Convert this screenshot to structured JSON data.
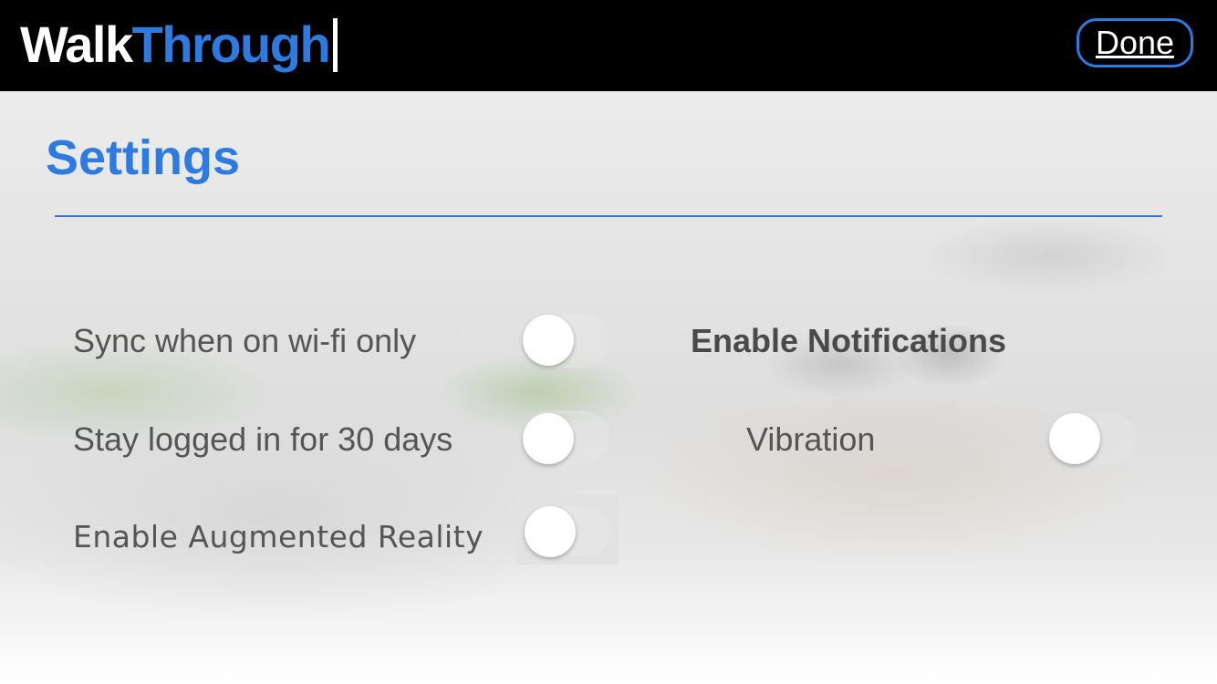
{
  "header": {
    "logo_part1": "Walk",
    "logo_part2": "Through",
    "done_label": "Done"
  },
  "settings": {
    "title": "Settings",
    "options": [
      {
        "label": "Sync when on wi-fi only",
        "enabled": false
      },
      {
        "label": "Stay logged in for 30 days",
        "enabled": false
      },
      {
        "label": "Enable Augmented Reality",
        "enabled": false
      }
    ],
    "notifications": {
      "heading": "Enable Notifications",
      "vibration_label": "Vibration",
      "vibration_enabled": false
    }
  },
  "colors": {
    "accent": "#2d7ae0",
    "header_bg": "#000000",
    "label_text": "#555555"
  }
}
